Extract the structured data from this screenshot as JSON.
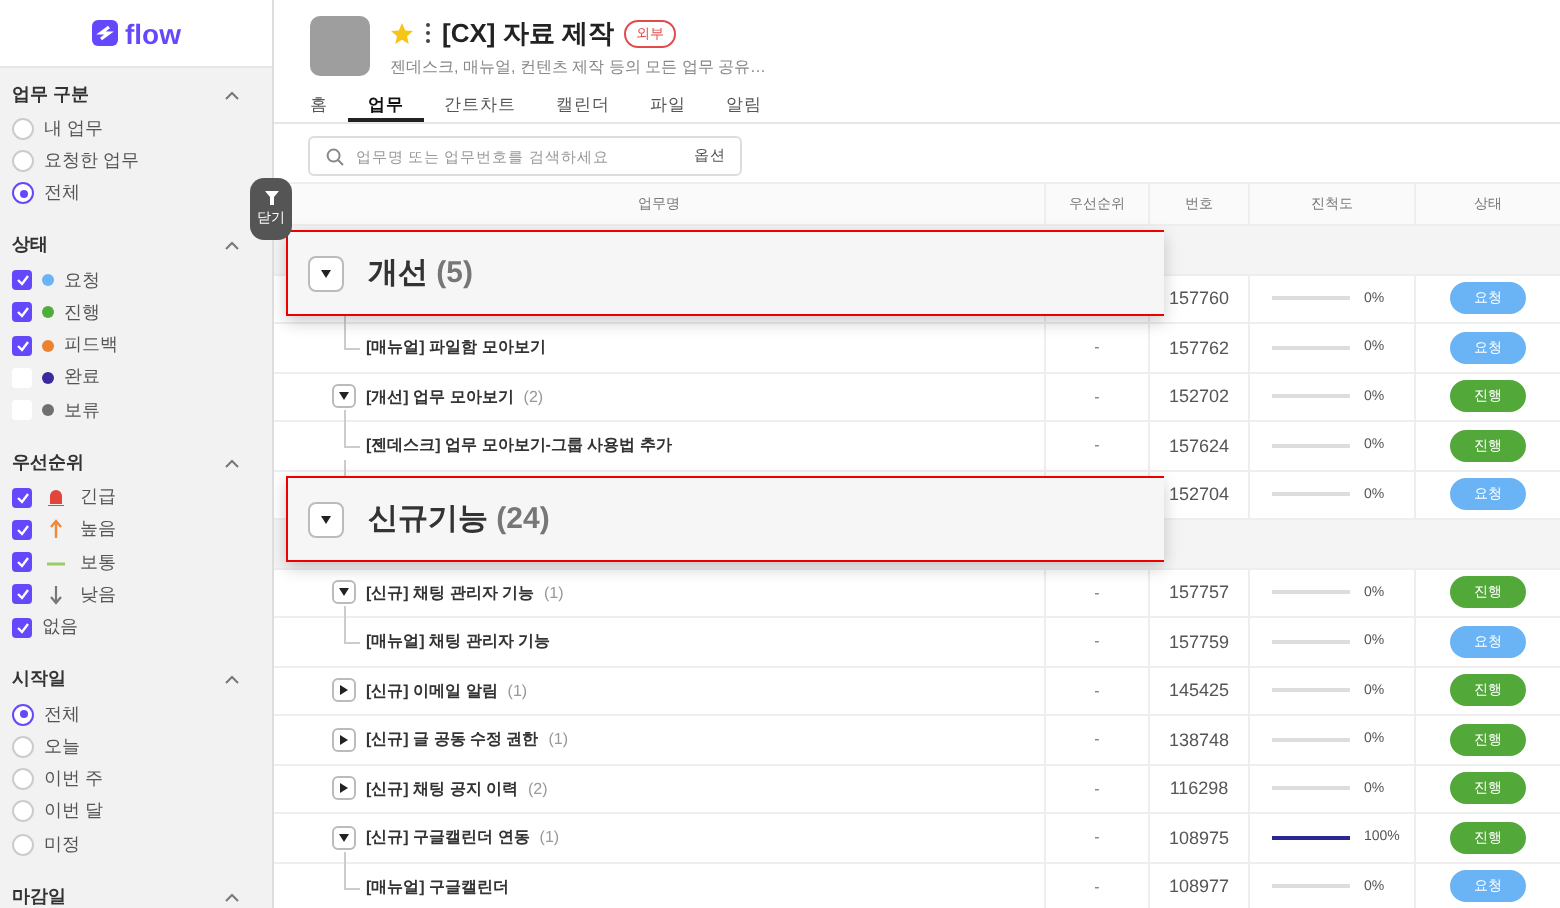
{
  "sidebar": {
    "logo": "flow",
    "filter_handle": "닫기",
    "sections": [
      {
        "title": "업무 구분",
        "expanded": true,
        "kind": "radio",
        "options": [
          {
            "label": "내 업무",
            "selected": false
          },
          {
            "label": "요청한 업무",
            "selected": false
          },
          {
            "label": "전체",
            "selected": true
          }
        ]
      },
      {
        "title": "상태",
        "expanded": true,
        "kind": "check",
        "options": [
          {
            "label": "요청",
            "checked": true,
            "color": "#6ab4f5"
          },
          {
            "label": "진행",
            "checked": true,
            "color": "#4fae3a"
          },
          {
            "label": "피드백",
            "checked": true,
            "color": "#ea8231"
          },
          {
            "label": "완료",
            "checked": false,
            "color": "#3a2aa0"
          },
          {
            "label": "보류",
            "checked": false,
            "color": "#707070"
          }
        ]
      },
      {
        "title": "우선순위",
        "expanded": true,
        "kind": "check",
        "options": [
          {
            "label": "긴급",
            "checked": true,
            "kind": "urgent"
          },
          {
            "label": "높음",
            "checked": true,
            "kind": "high"
          },
          {
            "label": "보통",
            "checked": true,
            "kind": "normal"
          },
          {
            "label": "낮음",
            "checked": true,
            "kind": "low"
          },
          {
            "label": "없음",
            "checked": true,
            "kind": "none"
          }
        ]
      },
      {
        "title": "시작일",
        "expanded": true,
        "kind": "radio",
        "options": [
          {
            "label": "전체",
            "selected": true
          },
          {
            "label": "오늘",
            "selected": false
          },
          {
            "label": "이번 주",
            "selected": false
          },
          {
            "label": "이번 달",
            "selected": false
          },
          {
            "label": "미정",
            "selected": false
          }
        ]
      },
      {
        "title": "마감일",
        "expanded": true
      }
    ]
  },
  "project": {
    "title": "[CX] 자료 제작",
    "favorite": true,
    "badge": "외부",
    "description": "젠데스크, 매뉴얼, 컨텐츠 제작 등의 모든 업무 공유…",
    "tabs": [
      {
        "label": "홈",
        "selected": false
      },
      {
        "label": "업무",
        "selected": true
      },
      {
        "label": "간트차트",
        "selected": false
      },
      {
        "label": "캘린더",
        "selected": false
      },
      {
        "label": "파일",
        "selected": false
      },
      {
        "label": "알림",
        "selected": false
      }
    ],
    "search": {
      "placeholder": "업무명 또는 업무번호를 검색하세요",
      "option": "옵션"
    }
  },
  "table": {
    "columns": [
      "업무명",
      "우선순위",
      "번호",
      "진척도",
      "상태"
    ],
    "groups": [
      {
        "title": "개선",
        "count": "(5)",
        "expanded": true,
        "rows": [
          {
            "number": "157760",
            "level": 0,
            "progress": "0%",
            "status": "요청",
            "color": "#6ab4f5",
            "children": [
              {
                "name": "[매뉴얼] 파일함 모아보기",
                "priority": "-",
                "number": "157762",
                "level": 0,
                "progress": "0%",
                "status": "요청",
                "color": "#6ab4f5"
              }
            ]
          },
          {
            "name": "[개선] 업무 모아보기",
            "count": "(2)",
            "expanded": true,
            "priority": "-",
            "number": "152702",
            "level": 0,
            "progress": "0%",
            "status": "진행",
            "color": "#53a83a",
            "children": [
              {
                "name": "[젠데스크] 업무 모아보기-그룹 사용법 추가",
                "priority": "-",
                "number": "157624",
                "level": 0,
                "progress": "0%",
                "status": "진행",
                "color": "#53a83a"
              },
              {
                "number": "152704",
                "level": 0,
                "progress": "0%",
                "status": "요청",
                "color": "#6ab4f5"
              }
            ]
          }
        ]
      },
      {
        "title": "신규기능",
        "count": "(24)",
        "expanded": true,
        "rows": [
          {
            "name": "[신규] 채팅 관리자 기능",
            "count": "(1)",
            "expanded": true,
            "priority": "-",
            "number": "157757",
            "level": 0,
            "progress": "0%",
            "status": "진행",
            "color": "#53a83a",
            "children": [
              {
                "name": "[매뉴얼] 채팅 관리자 기능",
                "priority": "-",
                "number": "157759",
                "level": 0,
                "progress": "0%",
                "status": "요청",
                "color": "#6ab4f5"
              }
            ]
          },
          {
            "name": "[신규] 이메일 알림",
            "count": "(1)",
            "expanded": false,
            "priority": "-",
            "number": "145425",
            "level": 0,
            "progress": "0%",
            "status": "진행",
            "color": "#53a83a"
          },
          {
            "name": "[신규] 글 공동 수정 권한",
            "count": "(1)",
            "expanded": false,
            "priority": "-",
            "number": "138748",
            "level": 0,
            "progress": "0%",
            "status": "진행",
            "color": "#53a83a"
          },
          {
            "name": "[신규] 채팅 공지 이력",
            "count": "(2)",
            "expanded": false,
            "priority": "-",
            "number": "116298",
            "level": 0,
            "progress": "0%",
            "status": "진행",
            "color": "#53a83a"
          },
          {
            "name": "[신규] 구글캘린더 연동",
            "count": "(1)",
            "expanded": true,
            "priority": "-",
            "number": "108975",
            "level": 1,
            "progress": "100%",
            "status": "진행",
            "color": "#53a83a",
            "children": [
              {
                "name": "[매뉴얼] 구글캘린더",
                "priority": "-",
                "number": "108977",
                "level": 0,
                "progress": "0%",
                "status": "요청",
                "color": "#6ab4f5"
              }
            ]
          }
        ]
      }
    ]
  }
}
